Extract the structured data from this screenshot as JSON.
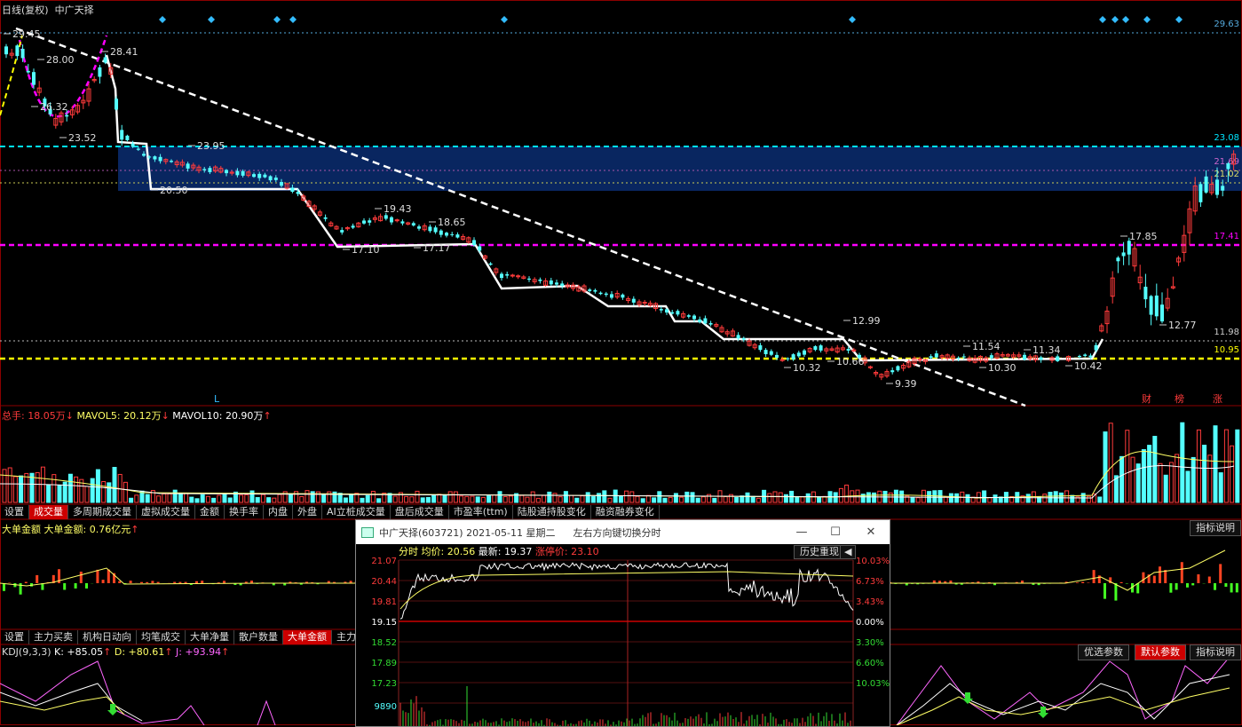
{
  "header": {
    "period": "日线(复权)",
    "stock_name": "中广天择"
  },
  "price_axis": [
    "29.63",
    "23.08",
    "21.69",
    "21.02",
    "17.41",
    "11.98",
    "10.95"
  ],
  "price_annotations": [
    "29.45",
    "28.00",
    "26.32",
    "23.52",
    "28.41",
    "23.95",
    "20.50",
    "19.43",
    "17.10",
    "18.65",
    "17.17",
    "12.99",
    "10.32",
    "10.66",
    "9.39",
    "11.54",
    "10.30",
    "11.34",
    "10.42",
    "17.85",
    "12.77"
  ],
  "event_marks": [
    "L",
    "财",
    "榜",
    "涨"
  ],
  "volume": {
    "total_label": "总手:",
    "total_value": "18.05万",
    "mavol5_label": "MAVOL5:",
    "mavol5_value": "20.12万",
    "mavol10_label": "MAVOL10:",
    "mavol10_value": "20.90万"
  },
  "tabs1": [
    "设置",
    "成交量",
    "多周期成交量",
    "虚拟成交量",
    "金额",
    "换手率",
    "内盘",
    "外盘",
    "AI立桩成交量",
    "盘后成交量",
    "市盈率(ttm)",
    "陆股通持股变化",
    "融资融券变化"
  ],
  "tabs1_active": 1,
  "big_order": {
    "title": "大单金额",
    "label": "大单金额:",
    "value": "0.76亿元",
    "explain": "指标说明"
  },
  "tabs2": [
    "设置",
    "主力买卖",
    "机构日动向",
    "均笔成交",
    "大单净量",
    "散户数量",
    "大单金额",
    "主力持"
  ],
  "tabs2_active": 6,
  "kdj": {
    "title": "KDJ(9,3,3)",
    "k": "K: +85.05",
    "d": "D: +80.61",
    "j": "J: +93.94",
    "btn_optimize": "优选参数",
    "btn_default": "默认参数",
    "btn_explain": "指标说明"
  },
  "popup": {
    "title": "中广天择(603721) 2021-05-11 星期二",
    "hint": "左右方向键切换分时",
    "minimize": "—",
    "maximize": "☐",
    "close": "✕",
    "bar_label": "分时",
    "avg_label": "均价:",
    "avg_value": "20.56",
    "last_label": "最新:",
    "last_value": "19.37",
    "limit_label": "涨停价:",
    "limit_value": "23.10",
    "history_btn": "历史重现",
    "left_axis": [
      "21.07",
      "20.44",
      "19.81",
      "19.15",
      "18.52",
      "17.89",
      "17.23",
      "9890"
    ],
    "right_axis": [
      "10.03%",
      "6.73%",
      "3.43%",
      "0.00%",
      "3.30%",
      "6.60%",
      "10.03%"
    ]
  },
  "colors": {
    "up": "#ff3b3b",
    "down": "#54ffff",
    "band": "#0a2a6a",
    "magenta": "#ff00ff",
    "yellow": "#ffff00",
    "cyan_dashed": "#00e5ff"
  }
}
